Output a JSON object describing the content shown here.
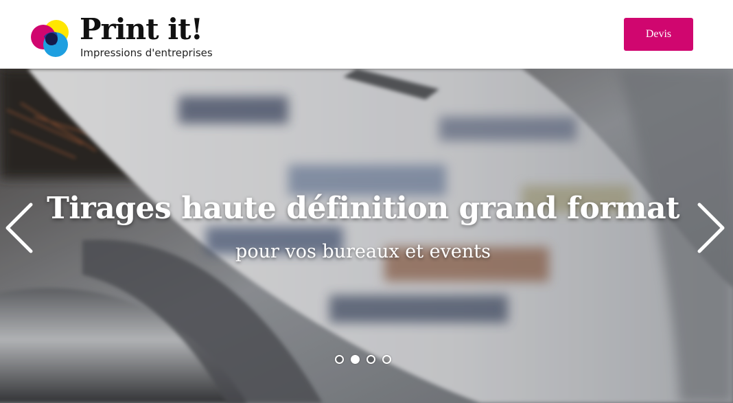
{
  "header": {
    "logo": {
      "title": "Print it!",
      "subtitle": "Impressions d'entreprises",
      "colors": {
        "yellow": "#ffe600",
        "magenta": "#d0066f",
        "cyan": "#1e9fe0",
        "blue": "#1d3b9c"
      }
    },
    "devis_label": "Devis",
    "accent_color": "#d0066f"
  },
  "carousel": {
    "headline": "Tirages haute définition grand format",
    "subline": "pour vos bureaux et events",
    "prev_icon": "chevron-left-icon",
    "next_icon": "chevron-right-icon",
    "slide_count": 4,
    "active_slide": 2
  }
}
